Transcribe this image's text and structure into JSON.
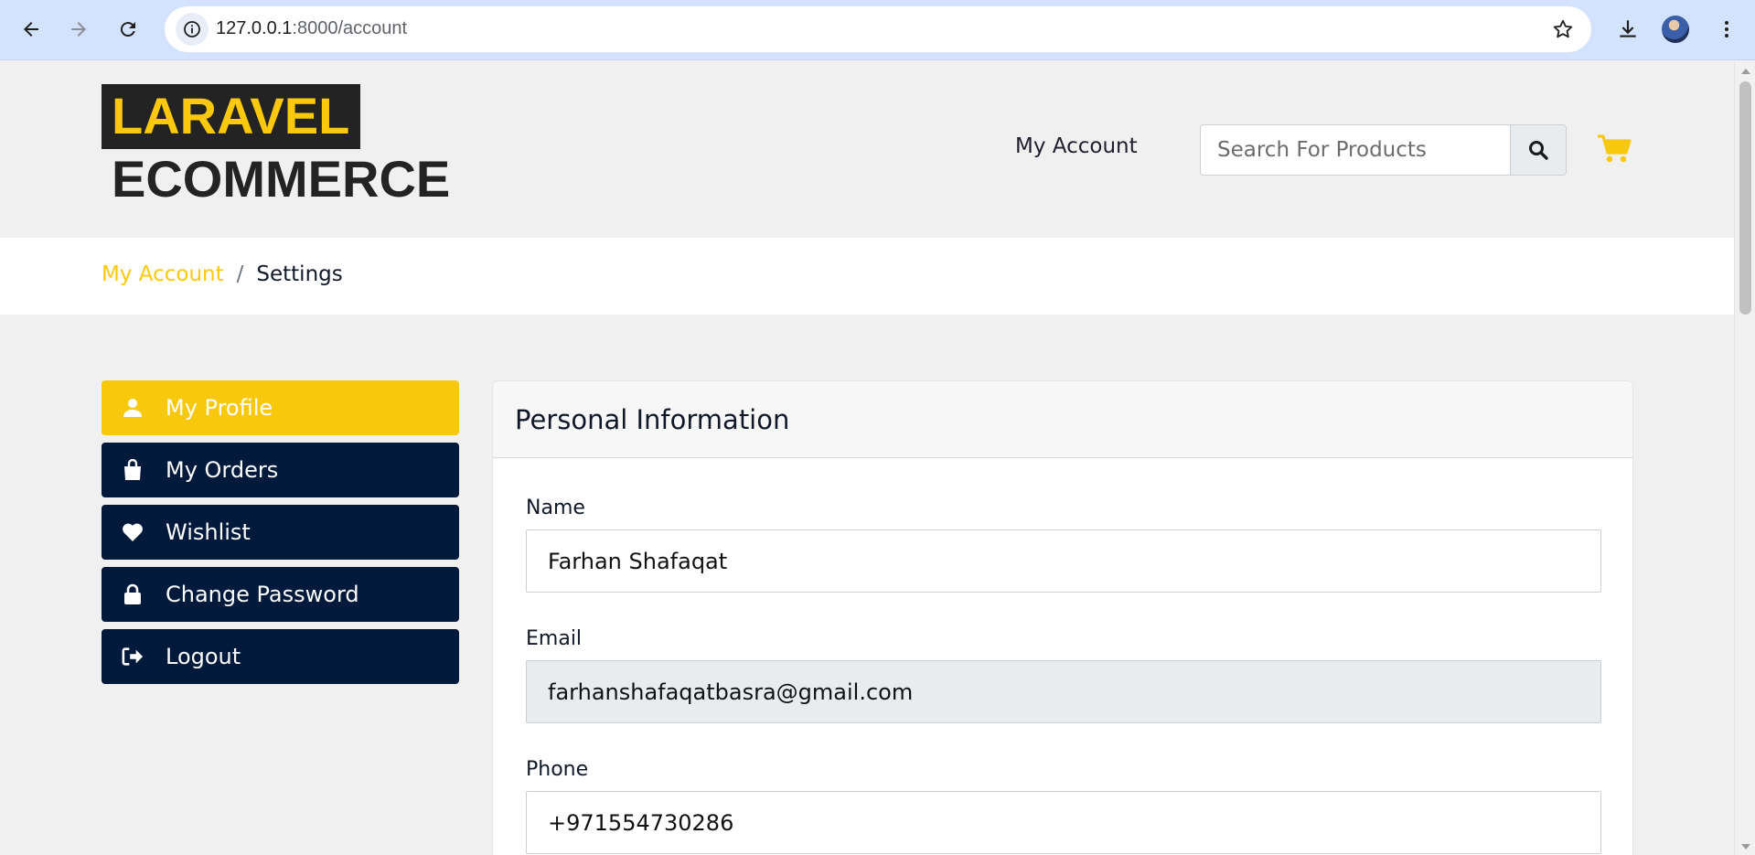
{
  "browser": {
    "url_host": "127.0.0.1",
    "url_rest": ":8000/account"
  },
  "header": {
    "logo_line1": "LARAVEL",
    "logo_line2": "ECOMMERCE",
    "account_link": "My Account",
    "search_placeholder": "Search For Products"
  },
  "breadcrumb": {
    "link": "My Account",
    "separator": "/",
    "current": "Settings"
  },
  "sidebar": {
    "items": [
      {
        "label": "My Profile",
        "icon": "user-icon",
        "active": true
      },
      {
        "label": "My Orders",
        "icon": "shopping-bag-icon",
        "active": false
      },
      {
        "label": "Wishlist",
        "icon": "heart-icon",
        "active": false
      },
      {
        "label": "Change Password",
        "icon": "lock-icon",
        "active": false
      },
      {
        "label": "Logout",
        "icon": "sign-out-icon",
        "active": false
      }
    ]
  },
  "profile": {
    "title": "Personal Information",
    "name_label": "Name",
    "name_value": "Farhan Shafaqat",
    "email_label": "Email",
    "email_value": "farhanshafaqatbasra@gmail.com",
    "phone_label": "Phone",
    "phone_value": "+971554730286"
  },
  "colors": {
    "accent": "#f8c80d",
    "sidebar_bg": "#011a3c",
    "logo_bg": "#232323"
  }
}
